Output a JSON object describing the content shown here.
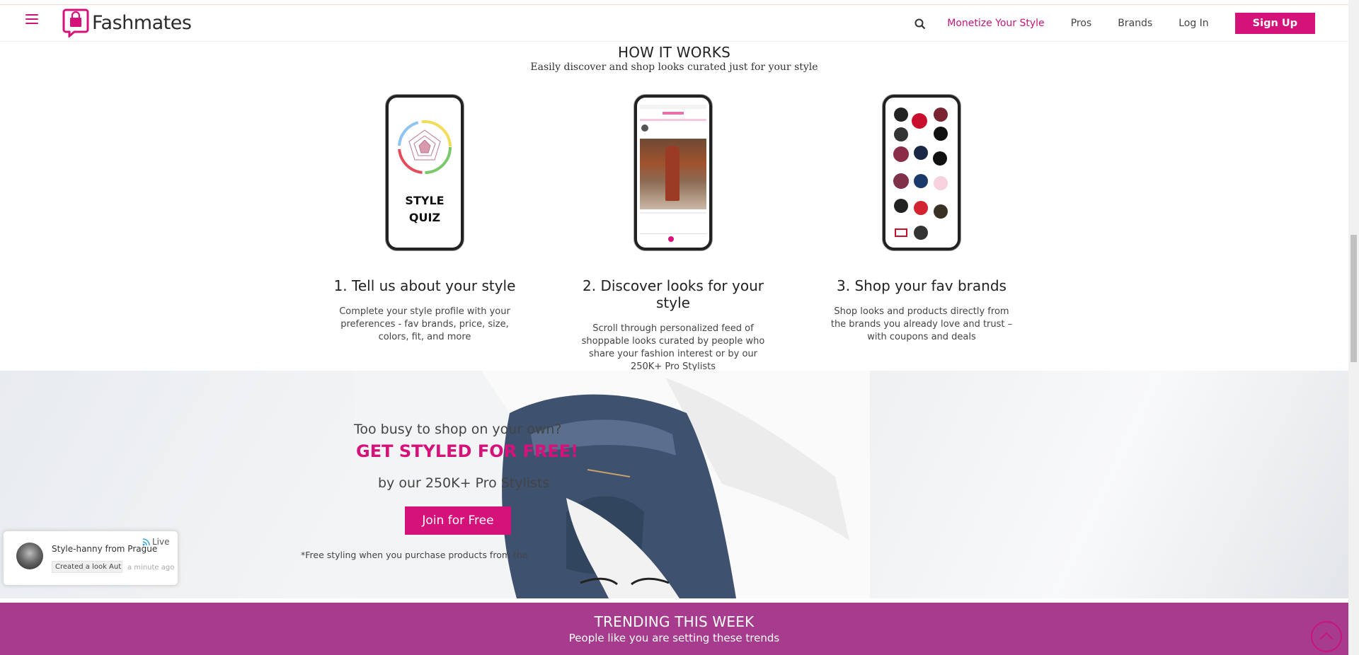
{
  "header": {
    "brand": "Fashmates",
    "nav": {
      "monetize": "Monetize Your Style",
      "pros": "Pros",
      "brands": "Brands",
      "login": "Log In",
      "signup": "Sign Up"
    }
  },
  "how_it_works": {
    "title": "HOW IT WORKS",
    "subtitle": "Easily discover and shop looks curated just for your style",
    "steps": [
      {
        "title": "1. Tell us about your style",
        "desc": "Complete your style profile with your preferences - fav brands, price, size, colors, fit, and more",
        "phone_text_1": "STYLE",
        "phone_text_2": "QUIZ"
      },
      {
        "title": "2. Discover looks for your style",
        "desc": "Scroll through personalized feed of shoppable looks curated by people who share your fashion interest or by our 250K+ Pro Stylists"
      },
      {
        "title": "3. Shop your fav brands",
        "desc": "Shop looks and products directly from the brands you already love and trust – with coupons and deals"
      }
    ]
  },
  "hero": {
    "busy": "Too busy to shop on your own?",
    "styled": "GET STYLED FOR FREE!",
    "by": "by our 250K+ Pro Stylists",
    "cta": "Join for Free",
    "disclaimer": "*Free styling when you purchase products from the"
  },
  "live_popup": {
    "tag": "Live",
    "name": "Style-hanny from Prague",
    "action": "Created a look Aut...",
    "time": "a minute ago"
  },
  "trending": {
    "title": "TRENDING THIS WEEK",
    "subtitle": "People like you are setting these trends"
  },
  "colors": {
    "brand": "#d4127a",
    "trending_bg": "#a73b8d"
  }
}
